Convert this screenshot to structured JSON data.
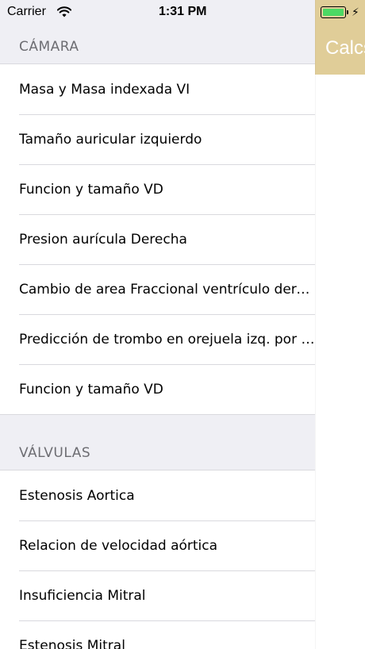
{
  "status_bar": {
    "carrier": "Carrier",
    "time": "1:31 PM",
    "battery_color": "#4cd964"
  },
  "main_panel": {
    "nav_color": "#e0cd98",
    "title": "Calcs"
  },
  "sections": [
    {
      "header": "CÁMARA",
      "items": [
        {
          "label": "Masa y Masa indexada VI"
        },
        {
          "label": "Tamaño auricular izquierdo"
        },
        {
          "label": "Funcion y tamaño VD"
        },
        {
          "label": "Presion aurícula Derecha"
        },
        {
          "label": "Cambio de area Fraccional ventrículo dere..."
        },
        {
          "label": "Predicción de trombo en orejuela izq. por f..."
        },
        {
          "label": "Funcion y tamaño VD"
        }
      ]
    },
    {
      "header": "VÁLVULAS",
      "items": [
        {
          "label": "Estenosis Aortica"
        },
        {
          "label": "Relacion de velocidad aórtica"
        },
        {
          "label": "Insuficiencia Mitral"
        },
        {
          "label": "Estenosis Mitral"
        }
      ]
    }
  ]
}
